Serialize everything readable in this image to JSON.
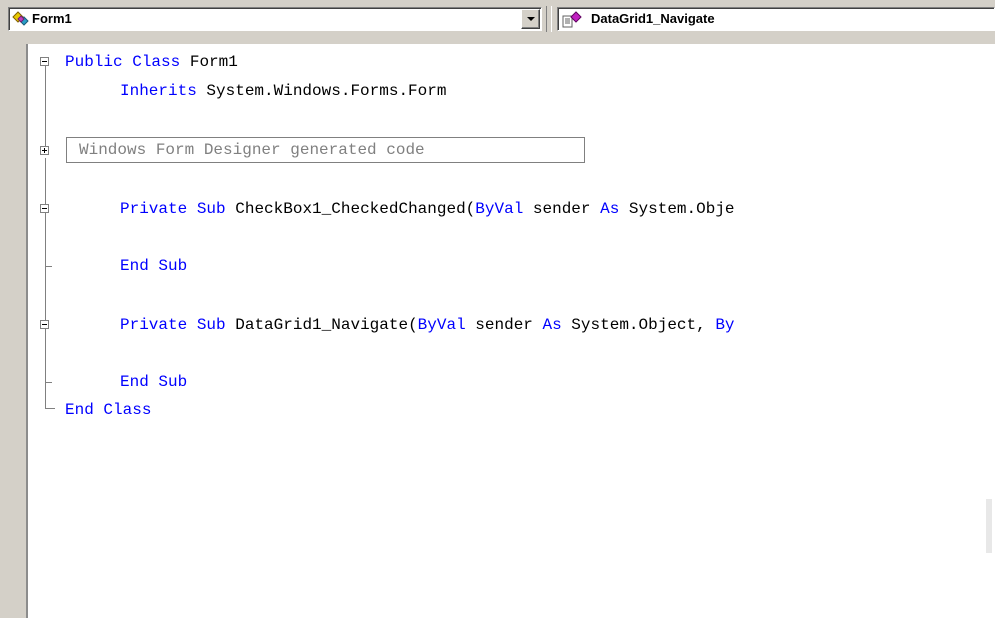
{
  "navbar": {
    "class_combo": {
      "value": "Form1",
      "icon": "class-icon"
    },
    "method_combo": {
      "value": "DataGrid1_Navigate",
      "icon": "method-icon"
    }
  },
  "editor": {
    "collapsed_region": "Windows Form Designer generated code",
    "lines": {
      "l1": {
        "kw1": "Public",
        "kw2": "Class",
        "rest": " Form1"
      },
      "l2": {
        "kw1": "Inherits",
        "rest": " System.Windows.Forms.Form"
      },
      "l3": {
        "kw1": "Private",
        "kw2": "Sub",
        "t1": " CheckBox1_CheckedChanged(",
        "kw3": "ByVal",
        "t2": " sender ",
        "kw4": "As",
        "t3": " System.Obje"
      },
      "l4": {
        "kw1": "End",
        "kw2": "Sub"
      },
      "l5": {
        "kw1": "Private",
        "kw2": "Sub",
        "t1": " DataGrid1_Navigate(",
        "kw3": "ByVal",
        "t2": " sender ",
        "kw4": "As",
        "t3": " System.Object, ",
        "kw5": "By"
      },
      "l6": {
        "kw1": "End",
        "kw2": "Sub"
      },
      "l7": {
        "kw1": "End",
        "kw2": "Class"
      }
    }
  },
  "colors": {
    "keyword": "#0000ff",
    "text": "#000000",
    "collapsed_text": "#808080",
    "chrome": "#d4d0c8"
  }
}
